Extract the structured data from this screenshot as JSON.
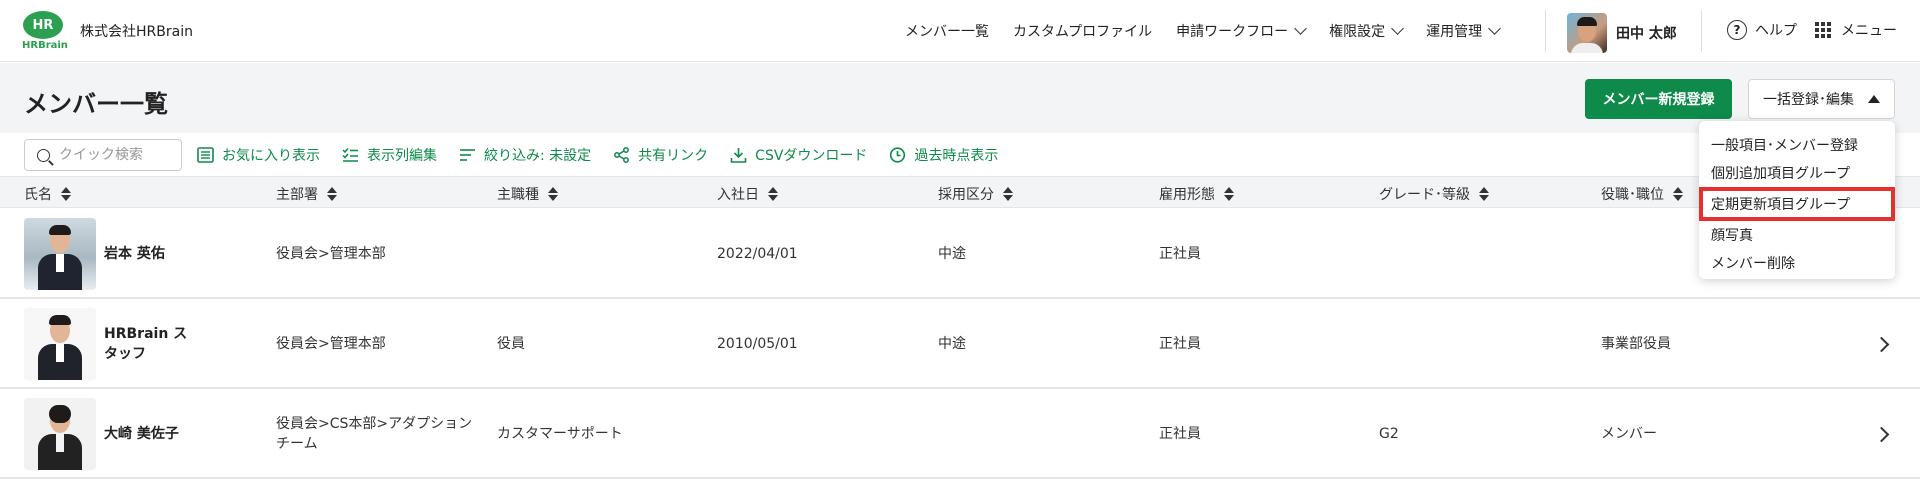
{
  "header": {
    "logo_text": "HR",
    "logo_word": "HRBrain",
    "company": "株式会社HRBrain",
    "nav": [
      {
        "label": "メンバー一覧",
        "dropdown": false
      },
      {
        "label": "カスタムプロファイル",
        "dropdown": false
      },
      {
        "label": "申請ワークフロー",
        "dropdown": true
      },
      {
        "label": "権限設定",
        "dropdown": true
      },
      {
        "label": "運用管理",
        "dropdown": true
      }
    ],
    "user_name": "田中 太郎",
    "help_label": "ヘルプ",
    "menu_label": "メニュー"
  },
  "page": {
    "title": "メンバー一覧",
    "new_button": "メンバー新規登録",
    "bulk_button": "一括登録･編集"
  },
  "toolbar": {
    "search_placeholder": "クイック検索",
    "favorites": "お気に入り表示",
    "columns_edit": "表示列編集",
    "filter": "絞り込み: 未設定",
    "share": "共有リンク",
    "csv": "CSVダウンロード",
    "past": "過去時点表示"
  },
  "table": {
    "headers": [
      "氏名",
      "主部署",
      "主職種",
      "入社日",
      "採用区分",
      "雇用形態",
      "グレード･等級",
      "役職･職位"
    ],
    "rows": [
      {
        "name": "岩本 英佑",
        "dept": "役員会>管理本部",
        "job": "",
        "joined": "2022/04/01",
        "hire": "中途",
        "employment": "正社員",
        "grade": "",
        "position": ""
      },
      {
        "name": "HRBrain スタッフ",
        "name_l1": "HRBrain ス",
        "name_l2": "タッフ",
        "dept": "役員会>管理本部",
        "job": "役員",
        "joined": "2010/05/01",
        "hire": "中途",
        "employment": "正社員",
        "grade": "",
        "position": "事業部役員"
      },
      {
        "name": "大崎 美佐子",
        "dept_l1": "役員会>CS本部>アダプション",
        "dept_l2": "チーム",
        "job": "カスタマーサポート",
        "joined": "",
        "hire": "",
        "employment": "正社員",
        "grade": "G2",
        "position": "メンバー"
      }
    ]
  },
  "dropdown": {
    "items": [
      "一般項目･メンバー登録",
      "個別追加項目グループ",
      "定期更新項目グループ",
      "顔写真",
      "メンバー削除"
    ],
    "highlighted_index": 2,
    "highlight_color": "#e53030"
  },
  "colors": {
    "brand_green": "#0e8a4a",
    "logo_green": "#2aa050"
  }
}
